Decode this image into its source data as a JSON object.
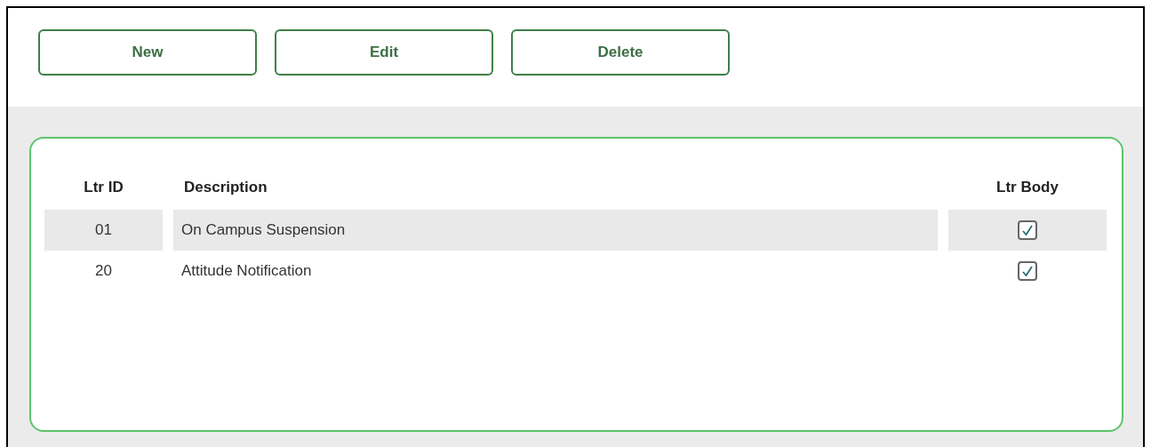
{
  "toolbar": {
    "buttons": [
      "New",
      "Edit",
      "Delete"
    ]
  },
  "table": {
    "columns": [
      "Ltr ID",
      "Description",
      "Ltr Body"
    ],
    "rows": [
      {
        "ltr_id": "01",
        "description": "On Campus Suspension",
        "ltr_body": true
      },
      {
        "ltr_id": "20",
        "description": "Attitude Notification",
        "ltr_body": true
      }
    ]
  }
}
